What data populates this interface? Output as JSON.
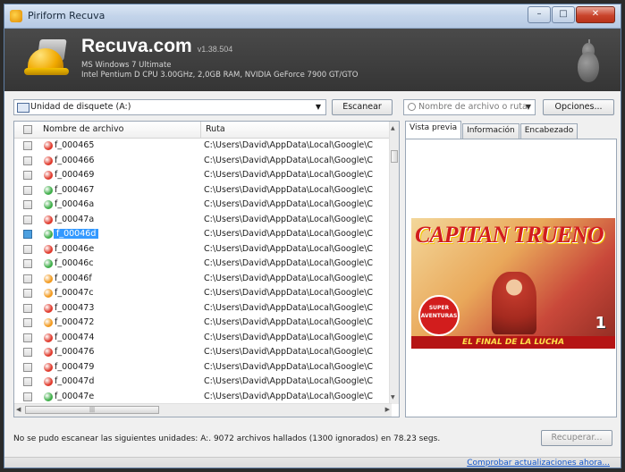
{
  "window": {
    "title": "Piriform Recuva"
  },
  "header": {
    "brand": "Recuva.com",
    "version": "v1.38.504",
    "os": "MS Windows 7 Ultimate",
    "hardware": "Intel Pentium D CPU 3.00GHz, 2,0GB RAM, NVIDIA GeForce 7900 GT/GTO"
  },
  "toolbar": {
    "drive": "Unidad de disquete (A:)",
    "scan_label": "Escanear",
    "search_placeholder": "Nombre de archivo o ruta",
    "options_label": "Opciones..."
  },
  "table": {
    "columns": [
      "Nombre de archivo",
      "Ruta"
    ],
    "rows": [
      {
        "name": "f_000465",
        "path": "C:\\Users\\David\\AppData\\Local\\Google\\C",
        "status": "red"
      },
      {
        "name": "f_000466",
        "path": "C:\\Users\\David\\AppData\\Local\\Google\\C",
        "status": "red"
      },
      {
        "name": "f_000469",
        "path": "C:\\Users\\David\\AppData\\Local\\Google\\C",
        "status": "red"
      },
      {
        "name": "f_000467",
        "path": "C:\\Users\\David\\AppData\\Local\\Google\\C",
        "status": "green"
      },
      {
        "name": "f_00046a",
        "path": "C:\\Users\\David\\AppData\\Local\\Google\\C",
        "status": "green"
      },
      {
        "name": "f_00047a",
        "path": "C:\\Users\\David\\AppData\\Local\\Google\\C",
        "status": "red"
      },
      {
        "name": "f_00046d",
        "path": "C:\\Users\\David\\AppData\\Local\\Google\\C",
        "status": "green",
        "selected": true
      },
      {
        "name": "f_00046e",
        "path": "C:\\Users\\David\\AppData\\Local\\Google\\C",
        "status": "red"
      },
      {
        "name": "f_00046c",
        "path": "C:\\Users\\David\\AppData\\Local\\Google\\C",
        "status": "green"
      },
      {
        "name": "f_00046f",
        "path": "C:\\Users\\David\\AppData\\Local\\Google\\C",
        "status": "orange"
      },
      {
        "name": "f_00047c",
        "path": "C:\\Users\\David\\AppData\\Local\\Google\\C",
        "status": "orange"
      },
      {
        "name": "f_000473",
        "path": "C:\\Users\\David\\AppData\\Local\\Google\\C",
        "status": "red"
      },
      {
        "name": "f_000472",
        "path": "C:\\Users\\David\\AppData\\Local\\Google\\C",
        "status": "orange"
      },
      {
        "name": "f_000474",
        "path": "C:\\Users\\David\\AppData\\Local\\Google\\C",
        "status": "red"
      },
      {
        "name": "f_000476",
        "path": "C:\\Users\\David\\AppData\\Local\\Google\\C",
        "status": "red"
      },
      {
        "name": "f_000479",
        "path": "C:\\Users\\David\\AppData\\Local\\Google\\C",
        "status": "red"
      },
      {
        "name": "f_00047d",
        "path": "C:\\Users\\David\\AppData\\Local\\Google\\C",
        "status": "red"
      },
      {
        "name": "f_00047e",
        "path": "C:\\Users\\David\\AppData\\Local\\Google\\C",
        "status": "green"
      }
    ]
  },
  "status_colors": {
    "red": "#e03a2c",
    "green": "#3fae49",
    "orange": "#f29a1f",
    "selected": "#3399ff"
  },
  "preview": {
    "tabs": [
      "Vista previa",
      "Información",
      "Encabezado"
    ],
    "active_tab": 0,
    "comic_title": "CAPITAN TRUENO",
    "comic_subtitle": "EL FINAL DE LA LUCHA",
    "comic_badge": "SUPER AVENTURAS",
    "comic_number": "1"
  },
  "status": {
    "message": "No se pudo escanear las siguientes unidades: A:.  9072 archivos hallados (1300 ignorados) en 78.23 segs.",
    "recover_label": "Recuperar...",
    "update_link": "Comprobar actualizaciones ahora..."
  }
}
